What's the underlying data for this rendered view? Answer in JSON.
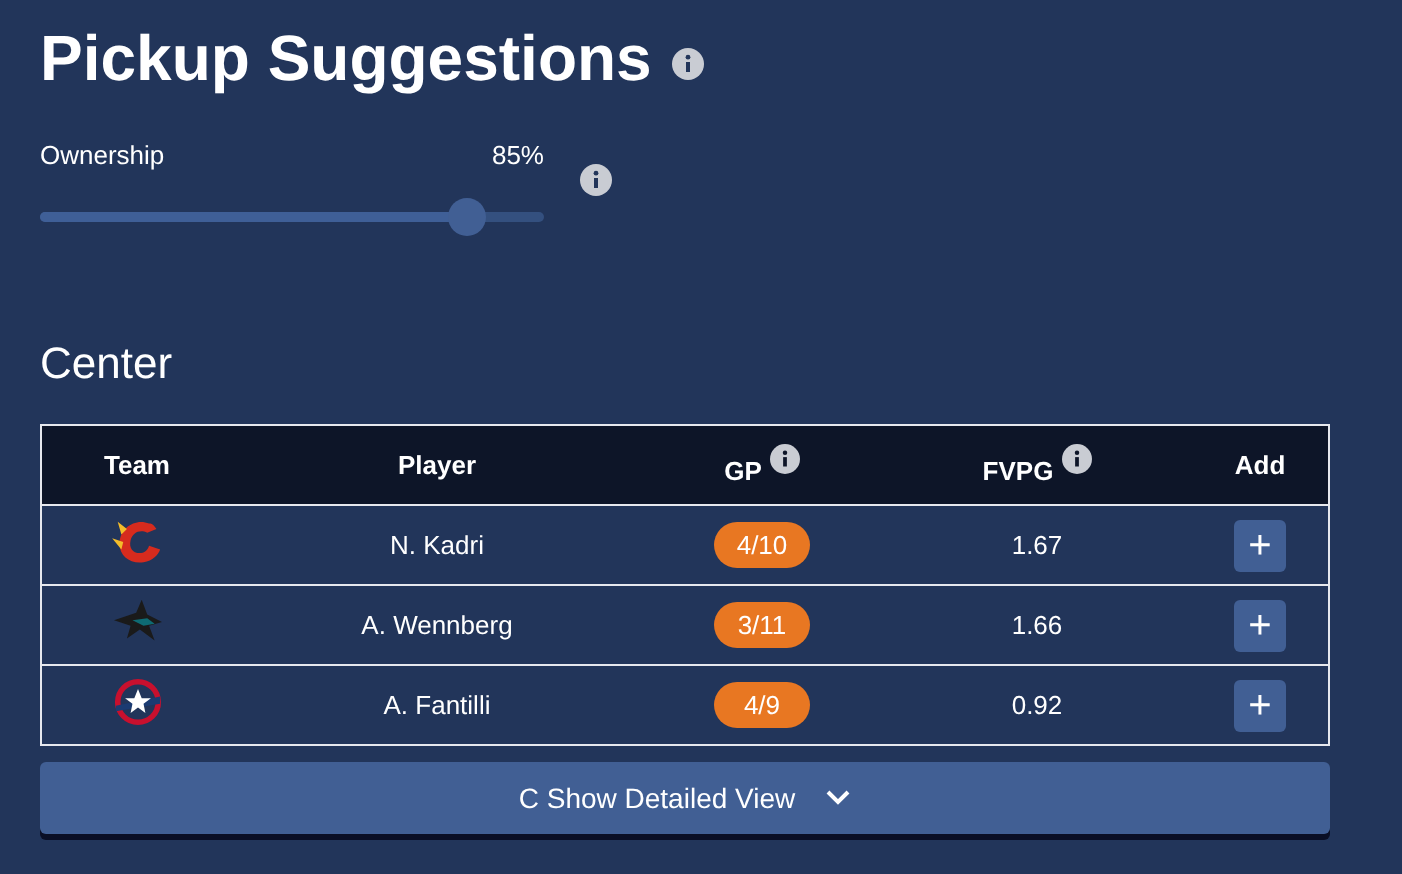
{
  "title": "Pickup Suggestions",
  "ownership": {
    "label": "Ownership",
    "reading": "85%",
    "level": 0.85
  },
  "section": "Center",
  "table": {
    "columns": [
      {
        "label": "Team",
        "info": false
      },
      {
        "label": "Player",
        "info": false
      },
      {
        "label": "GP",
        "info": true
      },
      {
        "label": "FVPG",
        "info": true
      },
      {
        "label": "Add",
        "info": false
      }
    ],
    "rows": [
      {
        "team": {
          "kind": "flame"
        },
        "player": "N. Kadri",
        "gp": "4/10",
        "fvpg": "1.67",
        "add": "+"
      },
      {
        "team": {
          "kind": "shark"
        },
        "player": "A. Wennberg",
        "gp": "3/11",
        "fvpg": "1.66",
        "add": "+"
      },
      {
        "team": {
          "kind": "star"
        },
        "player": "A. Fantilli",
        "gp": "4/9",
        "fvpg": "0.92",
        "add": "+"
      }
    ]
  },
  "detail_button": "C Show Detailed View"
}
